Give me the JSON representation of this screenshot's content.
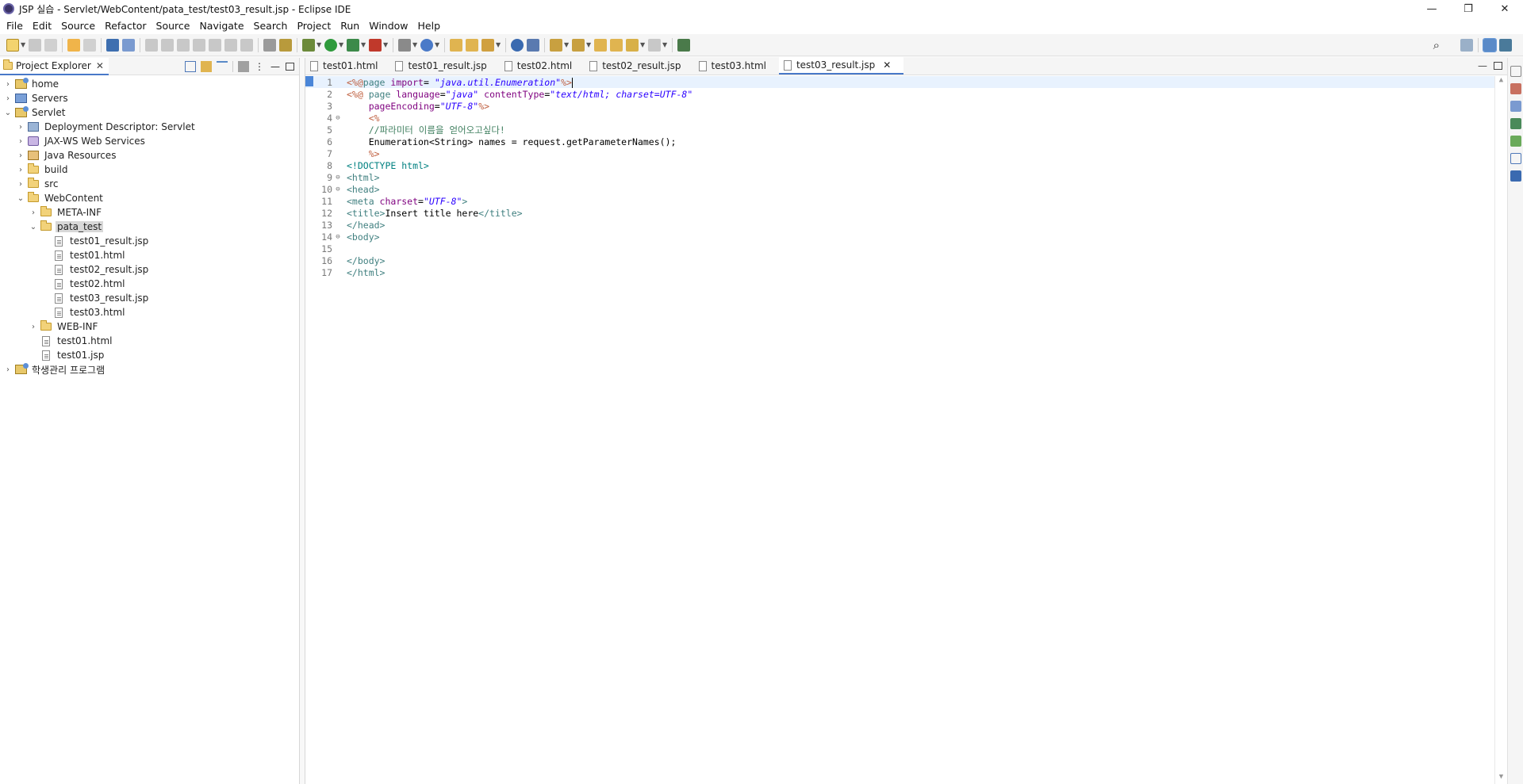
{
  "window": {
    "title": "JSP 실습 - Servlet/WebContent/pata_test/test03_result.jsp - Eclipse IDE",
    "controls": {
      "minimize": "—",
      "restore": "❐",
      "close": "✕"
    }
  },
  "menu": [
    "File",
    "Edit",
    "Source",
    "Refactor",
    "Source",
    "Navigate",
    "Search",
    "Project",
    "Run",
    "Window",
    "Help"
  ],
  "explorer": {
    "tab_label": "Project Explorer",
    "close_glyph": "✕",
    "tree": [
      {
        "label": "home",
        "depth": 0,
        "expanded": false,
        "icon": "project-icon"
      },
      {
        "label": "Servers",
        "depth": 0,
        "expanded": false,
        "icon": "servers-icon"
      },
      {
        "label": "Servlet",
        "depth": 0,
        "expanded": true,
        "icon": "project-icon"
      },
      {
        "label": "Deployment Descriptor: Servlet",
        "depth": 1,
        "expanded": false,
        "icon": "deployment-descriptor-icon"
      },
      {
        "label": "JAX-WS Web Services",
        "depth": 1,
        "expanded": false,
        "icon": "web-services-icon"
      },
      {
        "label": "Java Resources",
        "depth": 1,
        "expanded": false,
        "icon": "java-resources-icon"
      },
      {
        "label": "build",
        "depth": 1,
        "expanded": false,
        "icon": "folder-icon"
      },
      {
        "label": "src",
        "depth": 1,
        "expanded": false,
        "icon": "folder-icon"
      },
      {
        "label": "WebContent",
        "depth": 1,
        "expanded": true,
        "icon": "folder-icon"
      },
      {
        "label": "META-INF",
        "depth": 2,
        "expanded": false,
        "icon": "folder-icon"
      },
      {
        "label": "pata_test",
        "depth": 2,
        "expanded": true,
        "icon": "folder-icon",
        "selected": true
      },
      {
        "label": "test01_result.jsp",
        "depth": 3,
        "icon": "file-icon"
      },
      {
        "label": "test01.html",
        "depth": 3,
        "icon": "file-icon"
      },
      {
        "label": "test02_result.jsp",
        "depth": 3,
        "icon": "file-icon"
      },
      {
        "label": "test02.html",
        "depth": 3,
        "icon": "file-icon"
      },
      {
        "label": "test03_result.jsp",
        "depth": 3,
        "icon": "file-icon"
      },
      {
        "label": "test03.html",
        "depth": 3,
        "icon": "file-icon"
      },
      {
        "label": "WEB-INF",
        "depth": 2,
        "expanded": false,
        "icon": "folder-icon"
      },
      {
        "label": "test01.html",
        "depth": 2,
        "icon": "file-icon"
      },
      {
        "label": "test01.jsp",
        "depth": 2,
        "icon": "file-icon"
      },
      {
        "label": "학생관리 프로그램",
        "depth": 0,
        "expanded": false,
        "icon": "project-icon"
      }
    ]
  },
  "editor": {
    "tabs": [
      {
        "label": "test01.html",
        "active": false
      },
      {
        "label": "test01_result.jsp",
        "active": false
      },
      {
        "label": "test02.html",
        "active": false
      },
      {
        "label": "test02_result.jsp",
        "active": false
      },
      {
        "label": "test03.html",
        "active": false
      },
      {
        "label": "test03_result.jsp",
        "active": true
      }
    ],
    "active_close_glyph": "✕",
    "lines": [
      {
        "n": "1",
        "fold": "",
        "current": true,
        "tokens": [
          [
            "jsp",
            "<%@"
          ],
          [
            "tk-tag",
            "page "
          ],
          [
            "attr",
            "import"
          ],
          [
            "plain",
            "= "
          ],
          [
            "str",
            "\"java.util.Enumeration\""
          ],
          [
            "jsp",
            "%>"
          ]
        ]
      },
      {
        "n": "2",
        "fold": "",
        "tokens": [
          [
            "jsp",
            "<%@ "
          ],
          [
            "tk-tag",
            "page "
          ],
          [
            "attr",
            "language"
          ],
          [
            "plain",
            "="
          ],
          [
            "str",
            "\"java\""
          ],
          [
            "plain",
            " "
          ],
          [
            "attr",
            "contentType"
          ],
          [
            "plain",
            "="
          ],
          [
            "str",
            "\"text/html; charset=UTF-8\""
          ]
        ]
      },
      {
        "n": "3",
        "fold": "",
        "tokens": [
          [
            "plain",
            "    "
          ],
          [
            "attr",
            "pageEncoding"
          ],
          [
            "plain",
            "="
          ],
          [
            "str",
            "\"UTF-8\""
          ],
          [
            "jsp",
            "%>"
          ]
        ]
      },
      {
        "n": "4",
        "fold": "⊖",
        "tokens": [
          [
            "plain",
            "    "
          ],
          [
            "jsp",
            "<%"
          ]
        ]
      },
      {
        "n": "5",
        "fold": "",
        "tokens": [
          [
            "plain",
            "    "
          ],
          [
            "cmt",
            "//파라미터 이름을 얻어오고싶다!"
          ]
        ]
      },
      {
        "n": "6",
        "fold": "",
        "tokens": [
          [
            "plain",
            "    Enumeration<String> names = request.getParameterNames();"
          ]
        ]
      },
      {
        "n": "7",
        "fold": "",
        "tokens": [
          [
            "plain",
            "    "
          ],
          [
            "jsp",
            "%>"
          ]
        ]
      },
      {
        "n": "8",
        "fold": "",
        "tokens": [
          [
            "dt",
            "<!DOCTYPE html>"
          ]
        ]
      },
      {
        "n": "9",
        "fold": "⊖",
        "tokens": [
          [
            "tag",
            "<html>"
          ]
        ]
      },
      {
        "n": "10",
        "fold": "⊖",
        "tokens": [
          [
            "tag",
            "<head>"
          ]
        ]
      },
      {
        "n": "11",
        "fold": "",
        "tokens": [
          [
            "tag",
            "<meta "
          ],
          [
            "attr",
            "charset"
          ],
          [
            "plain",
            "="
          ],
          [
            "str",
            "\"UTF-8\""
          ],
          [
            "tag",
            ">"
          ]
        ]
      },
      {
        "n": "12",
        "fold": "",
        "tokens": [
          [
            "tag",
            "<title>"
          ],
          [
            "plain",
            "Insert title here"
          ],
          [
            "tag",
            "</title>"
          ]
        ]
      },
      {
        "n": "13",
        "fold": "",
        "tokens": [
          [
            "tag",
            "</head>"
          ]
        ]
      },
      {
        "n": "14",
        "fold": "⊖",
        "tokens": [
          [
            "tag",
            "<body>"
          ]
        ]
      },
      {
        "n": "15",
        "fold": "",
        "tokens": [
          [
            "plain",
            ""
          ]
        ]
      },
      {
        "n": "16",
        "fold": "",
        "tokens": [
          [
            "tag",
            "</body>"
          ]
        ]
      },
      {
        "n": "17",
        "fold": "",
        "tokens": [
          [
            "tag",
            "</html>"
          ]
        ]
      }
    ]
  },
  "colors": {
    "accent": "#4878c8",
    "tag": "#3f7f7f",
    "attr": "#7f007f",
    "string": "#2a00ff",
    "jsp": "#bf5f3f",
    "comment": "#3f7f5f"
  }
}
